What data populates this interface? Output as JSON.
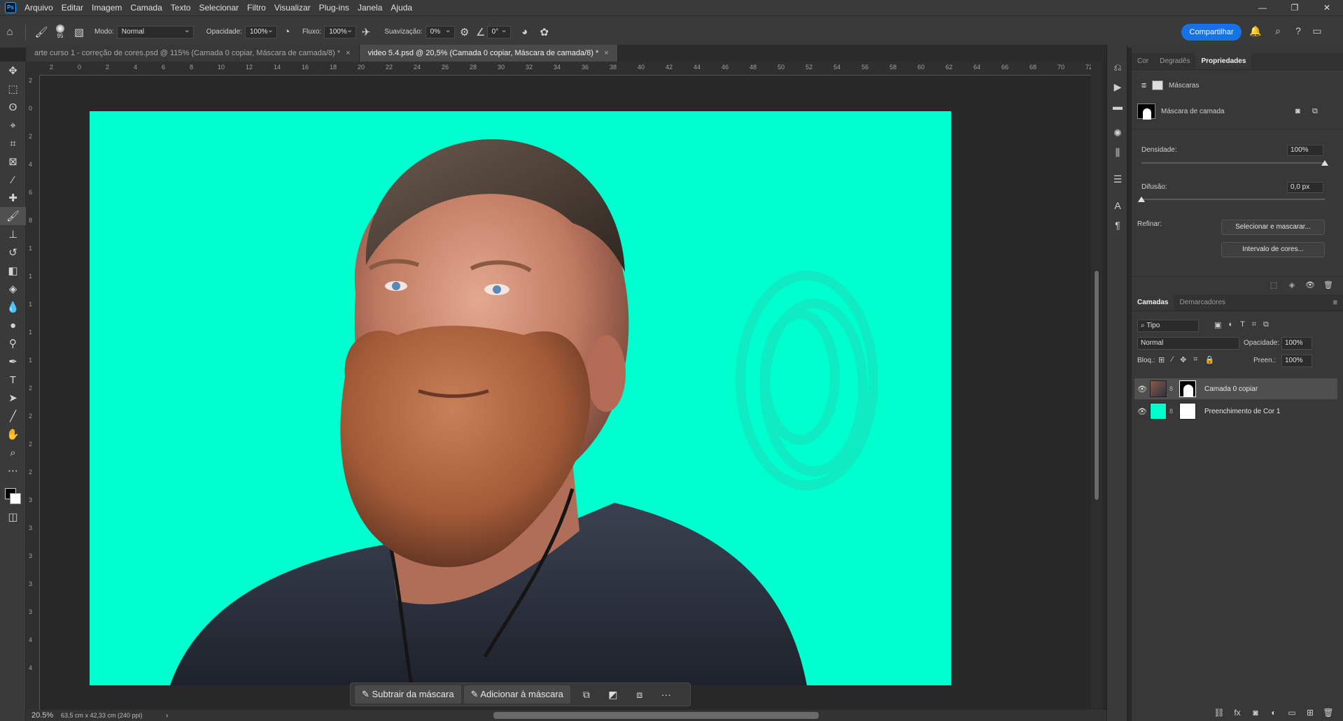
{
  "app": {
    "logo": "Ps"
  },
  "menu": [
    "Arquivo",
    "Editar",
    "Imagem",
    "Camada",
    "Texto",
    "Selecionar",
    "Filtro",
    "Visualizar",
    "Plug-ins",
    "Janela",
    "Ajuda"
  ],
  "window_controls": {
    "minimize": "—",
    "restore": "❐",
    "close": "✕"
  },
  "options": {
    "brush_size": "95",
    "mode_label": "Modo:",
    "mode_value": "Normal",
    "opacity_label": "Opacidade:",
    "opacity_value": "100%",
    "flow_label": "Fluxo:",
    "flow_value": "100%",
    "smoothing_label": "Suavização:",
    "smoothing_value": "0%",
    "angle_value": "0°",
    "share_label": "Compartilhar"
  },
  "doc_tabs": [
    {
      "label": "arte curso 1 - correção de cores.psd @ 115% (Camada 0 copiar, Máscara de camada/8) *",
      "close": "×"
    },
    {
      "label": "video 5.4.psd @ 20,5% (Camada 0 copiar, Máscara de camada/8) *",
      "close": "×"
    }
  ],
  "ruler_h": [
    "2",
    "0",
    "2",
    "4",
    "6",
    "8",
    "10",
    "12",
    "14",
    "16",
    "18",
    "20",
    "22",
    "24",
    "26",
    "28",
    "30",
    "32",
    "34",
    "36",
    "38",
    "40",
    "42",
    "44",
    "46",
    "48",
    "50",
    "52",
    "54",
    "56",
    "58",
    "60",
    "62",
    "64",
    "66",
    "68",
    "70",
    "72"
  ],
  "ruler_v": [
    "2",
    "0",
    "2",
    "4",
    "6",
    "8",
    "1",
    "1",
    "1",
    "1",
    "1",
    "2",
    "2",
    "2",
    "2",
    "3",
    "3",
    "3",
    "3",
    "3",
    "4",
    "4"
  ],
  "taskbar": {
    "subtract_label": "Subtrair da máscara",
    "add_label": "Adicionar à máscara",
    "more": "···"
  },
  "status": {
    "zoom": "20.5%",
    "doc_info": "63,5 cm x 42,33 cm (240 ppi)",
    "arrow": "›"
  },
  "properties": {
    "tabs": [
      "Cor",
      "Degradês",
      "Propriedades"
    ],
    "active_tab": "Propriedades",
    "section_title": "Máscaras",
    "mask_type": "Máscara de camada",
    "density_label": "Densidade:",
    "density_value": "100%",
    "density_level": 1.0,
    "feather_label": "Difusão:",
    "feather_value": "0,0 px",
    "feather_level": 0.0,
    "refine_label": "Refinar:",
    "select_mask_btn": "Selecionar e mascarar...",
    "color_range_btn": "Intervalo de cores..."
  },
  "layers": {
    "tabs": [
      "Camadas",
      "Demarcadores"
    ],
    "active_tab": "Camadas",
    "filter_label": "Tipo",
    "blend_mode": "Normal",
    "opacity_label": "Opacidade:",
    "opacity_value": "100%",
    "lock_label": "Bloq.:",
    "fill_label": "Preen.:",
    "fill_value": "100%",
    "items": [
      {
        "name": "Camada 0 copiar",
        "selected": true
      },
      {
        "name": "Preenchimento de Cor 1",
        "selected": false
      }
    ]
  },
  "colors": {
    "canvas_fill": "#00ffcf",
    "accent": "#1473e6"
  }
}
